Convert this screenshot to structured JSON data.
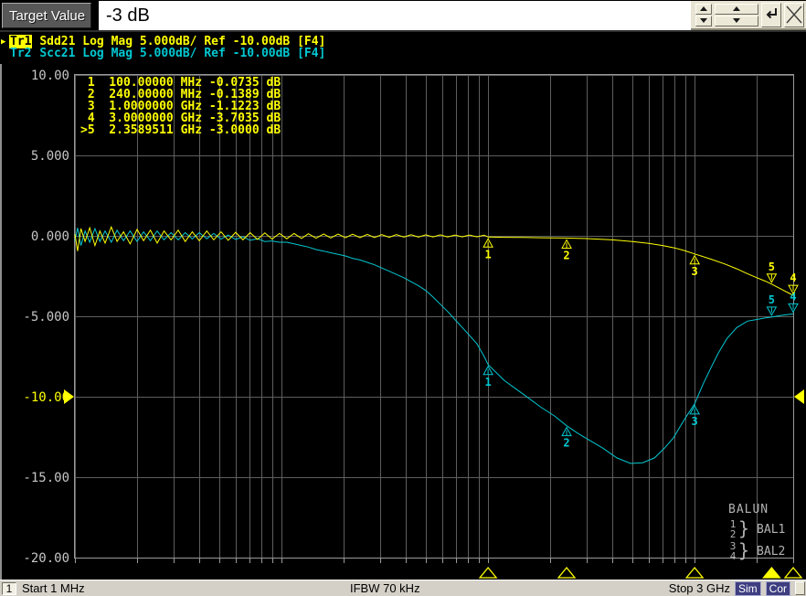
{
  "dialog": {
    "label": "Target Value",
    "value": "-3 dB"
  },
  "trace_info": [
    {
      "tag": "Tr1",
      "desc": "Sdd21 Log Mag 5.000dB/ Ref -10.00dB [F4]",
      "active": true
    },
    {
      "tag": "Tr2",
      "desc": "Scc21 Log Mag 5.000dB/ Ref -10.00dB [F4]",
      "active": false
    }
  ],
  "marker_table": [
    {
      "num": "1",
      "freq": "100.00000",
      "unit": "MHz",
      "val": "-0.0735",
      "vunit": "dB",
      "selected": false
    },
    {
      "num": "2",
      "freq": "240.00000",
      "unit": "MHz",
      "val": "-0.1389",
      "vunit": "dB",
      "selected": false
    },
    {
      "num": "3",
      "freq": "1.0000000",
      "unit": "GHz",
      "val": "-1.1223",
      "vunit": "dB",
      "selected": false
    },
    {
      "num": "4",
      "freq": "3.0000000",
      "unit": "GHz",
      "val": "-3.7035",
      "vunit": "dB",
      "selected": false
    },
    {
      "num": "5",
      "freq": "2.3589511",
      "unit": "GHz",
      "val": "-3.0000",
      "vunit": "dB",
      "selected": true
    }
  ],
  "balun": {
    "title": "BALUN",
    "brace": "}",
    "groups": [
      {
        "ports": [
          "1",
          "2"
        ],
        "label": "BAL1"
      },
      {
        "ports": [
          "3",
          "4"
        ],
        "label": "BAL2"
      }
    ]
  },
  "status": {
    "channel": "1",
    "start": "Start 1 MHz",
    "ifbw": "IFBW 70 kHz",
    "stop": "Stop 3 GHz",
    "badges": [
      "Sim",
      "Cor"
    ]
  },
  "colors": {
    "trace1": "#ffff00",
    "trace2": "#00c8d2",
    "grid": "#5e5e5e",
    "frame": "#9a9a9a",
    "axis_text": "#c6c6c6"
  },
  "chart_data": {
    "type": "line",
    "title": "",
    "x_axis": {
      "scale": "log",
      "start_mhz": 1,
      "stop_mhz": 3000,
      "start_label": "Start 1 MHz",
      "stop_label": "Stop 3 GHz"
    },
    "y_axis": {
      "min": -20,
      "max": 10,
      "step": 5,
      "ref_level": -10,
      "unit": "dB",
      "tick_labels": [
        "10.00",
        "5.000",
        "0.000",
        "-5.000",
        "-10.00",
        "-15.00",
        "-20.00"
      ]
    },
    "series": [
      {
        "name": "Scc21",
        "color": "#00c8d2",
        "points": [
          [
            1.0,
            -0.3
          ],
          [
            1.03,
            0.5
          ],
          [
            1.07,
            -0.6
          ],
          [
            1.12,
            0.3
          ],
          [
            1.18,
            -0.4
          ],
          [
            1.25,
            0.45
          ],
          [
            1.32,
            -0.35
          ],
          [
            1.4,
            0.3
          ],
          [
            1.5,
            -0.4
          ],
          [
            1.6,
            0.35
          ],
          [
            1.72,
            -0.3
          ],
          [
            1.85,
            0.3
          ],
          [
            2.0,
            -0.35
          ],
          [
            2.15,
            0.25
          ],
          [
            2.32,
            -0.3
          ],
          [
            2.5,
            0.3
          ],
          [
            2.7,
            -0.25
          ],
          [
            2.92,
            0.2
          ],
          [
            3.16,
            -0.25
          ],
          [
            3.42,
            0.2
          ],
          [
            3.7,
            -0.2
          ],
          [
            4.0,
            0.2
          ],
          [
            4.35,
            -0.18
          ],
          [
            4.7,
            0.15
          ],
          [
            5.1,
            -0.2
          ],
          [
            5.52,
            0.05
          ],
          [
            6.0,
            -0.22
          ],
          [
            6.5,
            -0.05
          ],
          [
            7.05,
            -0.28
          ],
          [
            7.65,
            -0.18
          ],
          [
            8.3,
            -0.35
          ],
          [
            9.0,
            -0.32
          ],
          [
            9.77,
            -0.4
          ],
          [
            10.6,
            -0.4
          ],
          [
            11.5,
            -0.5
          ],
          [
            12.5,
            -0.6
          ],
          [
            13.5,
            -0.7
          ],
          [
            14.7,
            -0.85
          ],
          [
            16.0,
            -0.95
          ],
          [
            17.3,
            -1.05
          ],
          [
            18.8,
            -1.15
          ],
          [
            20.4,
            -1.25
          ],
          [
            22.1,
            -1.4
          ],
          [
            24.0,
            -1.5
          ],
          [
            26.0,
            -1.65
          ],
          [
            28.2,
            -1.8
          ],
          [
            30.6,
            -2.0
          ],
          [
            33.2,
            -2.2
          ],
          [
            36.0,
            -2.4
          ],
          [
            39.1,
            -2.6
          ],
          [
            42.4,
            -2.85
          ],
          [
            46.0,
            -3.1
          ],
          [
            49.9,
            -3.4
          ],
          [
            54.1,
            -3.8
          ],
          [
            58.7,
            -4.25
          ],
          [
            63.7,
            -4.7
          ],
          [
            69.1,
            -5.2
          ],
          [
            75.0,
            -5.7
          ],
          [
            81.3,
            -6.2
          ],
          [
            88.2,
            -6.7
          ],
          [
            95.7,
            -7.5
          ],
          [
            100,
            -8.0
          ],
          [
            120,
            -9.0
          ],
          [
            150,
            -9.9
          ],
          [
            180,
            -10.65
          ],
          [
            210,
            -11.2
          ],
          [
            240,
            -11.8
          ],
          [
            270,
            -12.25
          ],
          [
            300,
            -12.6
          ],
          [
            360,
            -13.2
          ],
          [
            420,
            -13.8
          ],
          [
            490,
            -14.15
          ],
          [
            560,
            -14.1
          ],
          [
            640,
            -13.8
          ],
          [
            720,
            -13.15
          ],
          [
            790,
            -12.55
          ],
          [
            855,
            -11.8
          ],
          [
            920,
            -11.15
          ],
          [
            1000,
            -10.45
          ],
          [
            1100,
            -9.2
          ],
          [
            1200,
            -8.2
          ],
          [
            1300,
            -7.3
          ],
          [
            1430,
            -6.4
          ],
          [
            1600,
            -5.7
          ],
          [
            1800,
            -5.3
          ],
          [
            2000,
            -5.2
          ],
          [
            2200,
            -5.1
          ],
          [
            2359,
            -5.05
          ],
          [
            2600,
            -4.95
          ],
          [
            2800,
            -4.9
          ],
          [
            3000,
            -4.85
          ]
        ]
      },
      {
        "name": "Sdd21",
        "color": "#ffff00",
        "points": [
          [
            1.0,
            0.1
          ],
          [
            1.03,
            -0.95
          ],
          [
            1.07,
            0.45
          ],
          [
            1.12,
            -0.35
          ],
          [
            1.18,
            0.5
          ],
          [
            1.25,
            -0.6
          ],
          [
            1.32,
            0.3
          ],
          [
            1.4,
            -0.45
          ],
          [
            1.5,
            0.55
          ],
          [
            1.6,
            -0.35
          ],
          [
            1.72,
            0.25
          ],
          [
            1.85,
            -0.5
          ],
          [
            2.0,
            0.4
          ],
          [
            2.15,
            -0.3
          ],
          [
            2.32,
            0.35
          ],
          [
            2.5,
            -0.45
          ],
          [
            2.7,
            0.3
          ],
          [
            2.92,
            -0.25
          ],
          [
            3.16,
            0.35
          ],
          [
            3.42,
            -0.35
          ],
          [
            3.7,
            0.25
          ],
          [
            4.0,
            -0.3
          ],
          [
            4.35,
            0.3
          ],
          [
            4.7,
            -0.25
          ],
          [
            5.1,
            0.25
          ],
          [
            5.52,
            -0.28
          ],
          [
            6.0,
            0.22
          ],
          [
            6.5,
            -0.25
          ],
          [
            7.05,
            0.2
          ],
          [
            7.65,
            -0.22
          ],
          [
            8.3,
            0.18
          ],
          [
            9.0,
            -0.2
          ],
          [
            9.77,
            0.15
          ],
          [
            10.6,
            -0.18
          ],
          [
            11.5,
            0.15
          ],
          [
            12.5,
            -0.16
          ],
          [
            13.5,
            0.13
          ],
          [
            14.7,
            -0.15
          ],
          [
            16.0,
            0.12
          ],
          [
            17.3,
            -0.13
          ],
          [
            18.8,
            0.11
          ],
          [
            20.4,
            -0.12
          ],
          [
            22.1,
            0.1
          ],
          [
            24.0,
            -0.11
          ],
          [
            26.0,
            0.09
          ],
          [
            28.2,
            -0.1
          ],
          [
            30.6,
            0.08
          ],
          [
            33.2,
            -0.09
          ],
          [
            36.0,
            0.08
          ],
          [
            39.1,
            -0.08
          ],
          [
            42.4,
            0.07
          ],
          [
            46.0,
            -0.08
          ],
          [
            49.9,
            0.06
          ],
          [
            54.1,
            -0.07
          ],
          [
            58.7,
            0.06
          ],
          [
            63.7,
            -0.07
          ],
          [
            69.1,
            0.05
          ],
          [
            75.0,
            -0.06
          ],
          [
            81.3,
            0.05
          ],
          [
            88.2,
            -0.06
          ],
          [
            95.7,
            0.04
          ],
          [
            100,
            -0.0735
          ],
          [
            120,
            -0.09
          ],
          [
            150,
            -0.1
          ],
          [
            180,
            -0.12
          ],
          [
            240,
            -0.1389
          ],
          [
            300,
            -0.17
          ],
          [
            400,
            -0.25
          ],
          [
            500,
            -0.35
          ],
          [
            600,
            -0.47
          ],
          [
            700,
            -0.6
          ],
          [
            800,
            -0.75
          ],
          [
            900,
            -0.93
          ],
          [
            1000,
            -1.1223
          ],
          [
            1200,
            -1.45
          ],
          [
            1400,
            -1.75
          ],
          [
            1600,
            -2.05
          ],
          [
            1800,
            -2.35
          ],
          [
            2000,
            -2.6
          ],
          [
            2200,
            -2.82
          ],
          [
            2359,
            -3.0
          ],
          [
            2500,
            -3.17
          ],
          [
            2700,
            -3.4
          ],
          [
            2850,
            -3.55
          ],
          [
            3000,
            -3.7035
          ]
        ]
      }
    ],
    "markers": [
      {
        "label": "1",
        "f_mhz": 100,
        "style": "below",
        "active": false
      },
      {
        "label": "2",
        "f_mhz": 240,
        "style": "below",
        "active": false
      },
      {
        "label": "3",
        "f_mhz": 1000,
        "style": "below",
        "active": false
      },
      {
        "label": "4",
        "f_mhz": 3000,
        "style": "above",
        "active": false
      },
      {
        "label": "5",
        "f_mhz": 2358.9511,
        "style": "above",
        "active": true
      }
    ]
  }
}
